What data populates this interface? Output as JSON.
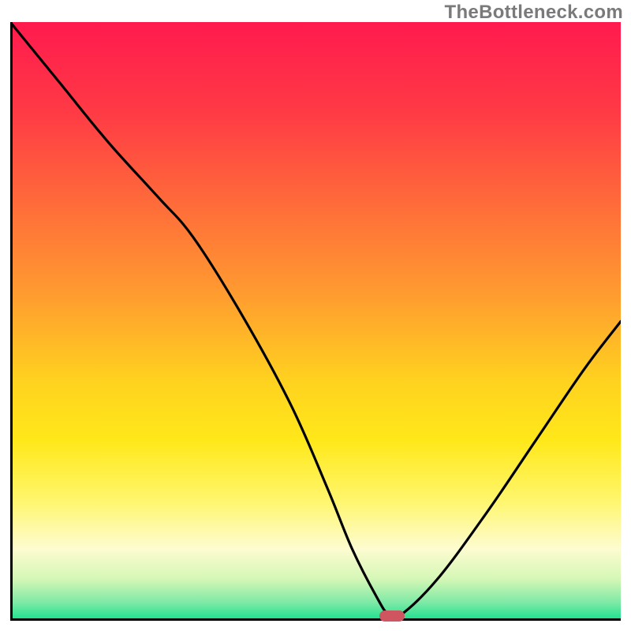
{
  "watermark": "TheBottleneck.com",
  "chart_data": {
    "type": "line",
    "title": "",
    "xlabel": "",
    "ylabel": "",
    "xlim": [
      0,
      100
    ],
    "ylim": [
      0,
      100
    ],
    "grid": false,
    "legend": false,
    "gradient_stops": [
      {
        "offset": 0.0,
        "color": "#ff1a4e"
      },
      {
        "offset": 0.15,
        "color": "#ff3a45"
      },
      {
        "offset": 0.3,
        "color": "#ff6a3a"
      },
      {
        "offset": 0.45,
        "color": "#ff9a30"
      },
      {
        "offset": 0.6,
        "color": "#ffd21f"
      },
      {
        "offset": 0.7,
        "color": "#ffe81a"
      },
      {
        "offset": 0.8,
        "color": "#fff66e"
      },
      {
        "offset": 0.88,
        "color": "#fdfcd0"
      },
      {
        "offset": 0.93,
        "color": "#d5f7b6"
      },
      {
        "offset": 0.97,
        "color": "#7de9a6"
      },
      {
        "offset": 1.0,
        "color": "#16e08e"
      }
    ],
    "series": [
      {
        "name": "bottleneck-curve",
        "color": "#000000",
        "x": [
          0,
          8,
          16,
          24,
          30,
          38,
          46,
          52,
          56,
          60,
          62,
          64,
          70,
          78,
          86,
          94,
          100
        ],
        "y": [
          100,
          90,
          80,
          71,
          64,
          51,
          36,
          22,
          12,
          4,
          1,
          1,
          7,
          18,
          30,
          42,
          50
        ]
      }
    ],
    "marker": {
      "x": 62.5,
      "y": 0.8,
      "color": "#cf5560"
    }
  }
}
